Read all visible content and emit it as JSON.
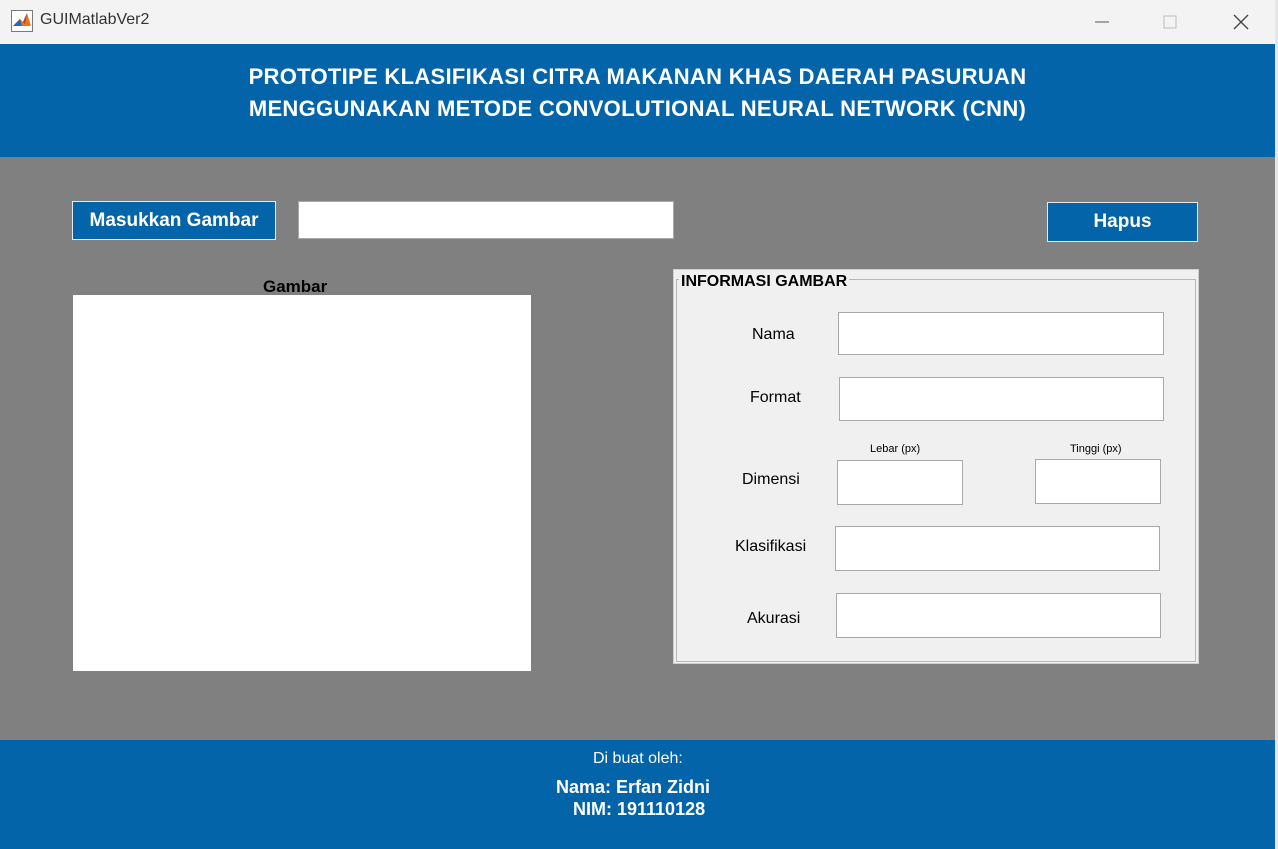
{
  "window": {
    "title": "GUIMatlabVer2",
    "controls": {
      "minimize": "minimize-icon",
      "maximize": "maximize-icon",
      "close": "close-icon"
    }
  },
  "header": {
    "line1": "PROTOTIPE KLASIFIKASI CITRA MAKANAN KHAS DAERAH PASURUAN",
    "line2": "MENGGUNAKAN METODE CONVOLUTIONAL NEURAL NETWORK (CNN)"
  },
  "toolbar": {
    "upload_label": "Masukkan Gambar",
    "path_value": "",
    "clear_label": "Hapus"
  },
  "image_area": {
    "title": "Gambar"
  },
  "info_panel": {
    "title": "INFORMASI GAMBAR",
    "name_label": "Nama",
    "name_value": "",
    "format_label": "Format",
    "format_value": "",
    "dimension_label": "Dimensi",
    "width_label": "Lebar (px)",
    "width_value": "",
    "height_label": "Tinggi (px)",
    "height_value": "",
    "class_label": "Klasifikasi",
    "class_value": "",
    "accuracy_label": "Akurasi",
    "accuracy_value": ""
  },
  "footer": {
    "made_by": "Di buat oleh:",
    "name": "Nama: Erfan Zidni",
    "nim": "NIM: 191110128"
  },
  "colors": {
    "brand_blue": "#0464aa",
    "background_gray": "#808080",
    "panel_gray": "#f0f0f0"
  }
}
